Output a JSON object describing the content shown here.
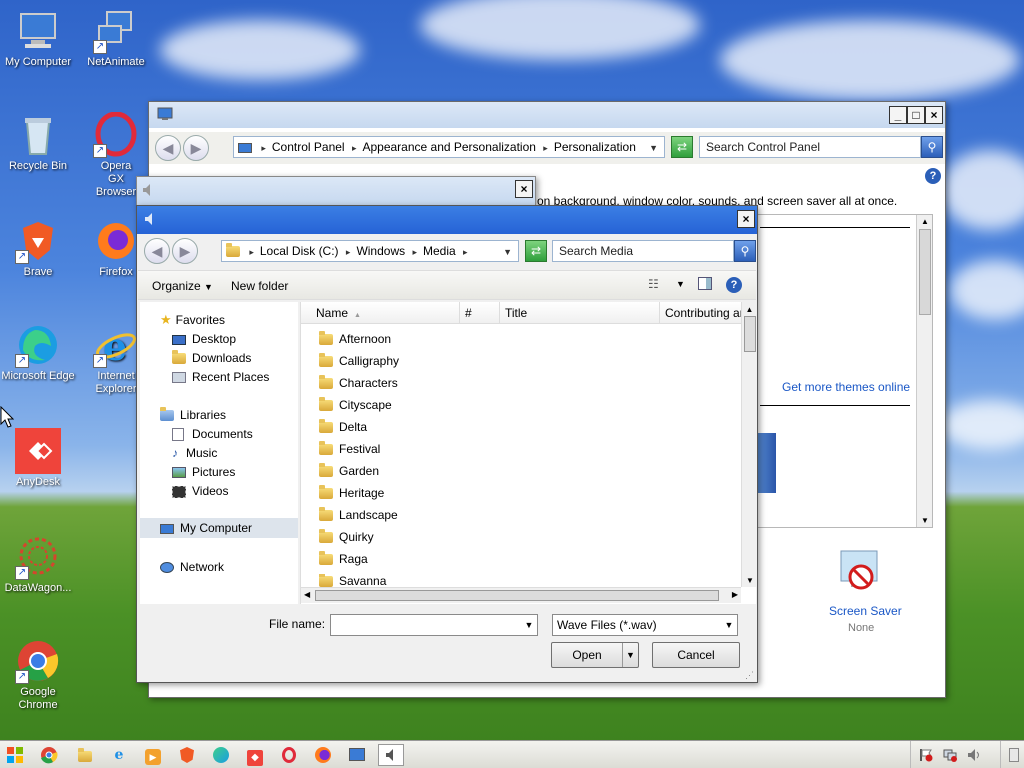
{
  "desktop": {
    "icons": [
      {
        "label": "My Computer",
        "icon": "computer-icon"
      },
      {
        "label": "NetAnimate",
        "icon": "network-computers-icon"
      },
      {
        "label": "Recycle Bin",
        "icon": "recycle-bin-icon"
      },
      {
        "label": "Opera GX Browser",
        "icon": "opera-gx-icon"
      },
      {
        "label": "Brave",
        "icon": "brave-icon"
      },
      {
        "label": "Firefox",
        "icon": "firefox-icon"
      },
      {
        "label": "Microsoft Edge",
        "icon": "edge-icon"
      },
      {
        "label": "Internet Explorer",
        "icon": "internet-explorer-icon"
      },
      {
        "label": "AnyDesk",
        "icon": "anydesk-icon"
      },
      {
        "label": "DataWagon...",
        "icon": "datawagon-icon"
      },
      {
        "label": "Google Chrome",
        "icon": "chrome-icon"
      }
    ]
  },
  "control_panel": {
    "address": {
      "crumbs": [
        "Control Panel",
        "Appearance and Personalization",
        "Personalization"
      ],
      "search_placeholder": "Search Control Panel"
    },
    "description": "on background, window color, sounds, and screen saver all at once.",
    "get_more_themes": "Get more themes online",
    "screen_saver": {
      "label": "Screen Saver",
      "value": "None"
    }
  },
  "sound_dialog": {},
  "open_dialog": {
    "address": {
      "crumbs": [
        "Local Disk (C:)",
        "Windows",
        "Media"
      ],
      "search_placeholder": "Search Media"
    },
    "toolbar": {
      "organize": "Organize",
      "new_folder": "New folder"
    },
    "nav": {
      "favorites_header": "Favorites",
      "favorites": [
        "Desktop",
        "Downloads",
        "Recent Places"
      ],
      "libraries_header": "Libraries",
      "libraries": [
        "Documents",
        "Music",
        "Pictures",
        "Videos"
      ],
      "my_computer": "My Computer",
      "network": "Network"
    },
    "columns": [
      "Name",
      "#",
      "Title",
      "Contributing art"
    ],
    "files": [
      "Afternoon",
      "Calligraphy",
      "Characters",
      "Cityscape",
      "Delta",
      "Festival",
      "Garden",
      "Heritage",
      "Landscape",
      "Quirky",
      "Raga",
      "Savanna"
    ],
    "file_name_label": "File name:",
    "file_name_value": "",
    "file_type": "Wave Files (*.wav)",
    "open_label": "Open",
    "cancel_label": "Cancel"
  },
  "taskbar": {
    "start_icon": "windows-start-icon",
    "items": [
      "chrome-icon",
      "file-explorer-icon",
      "internet-explorer-icon",
      "media-player-icon",
      "brave-icon",
      "edge-icon",
      "anydesk-icon",
      "opera-gx-icon",
      "firefox-icon",
      "control-panel-icon",
      "sound-icon"
    ]
  }
}
